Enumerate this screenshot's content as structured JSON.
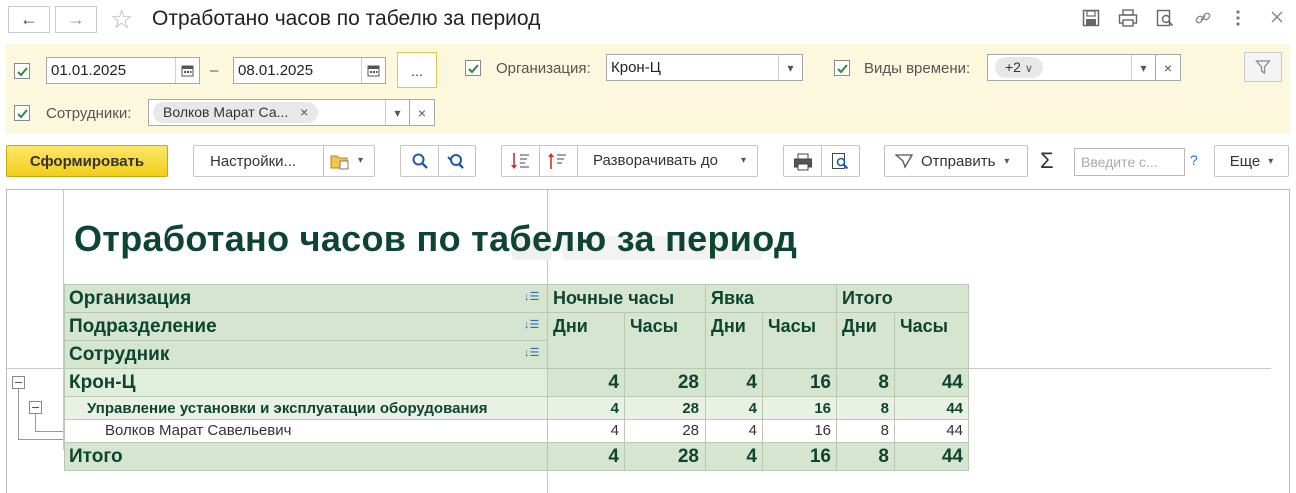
{
  "window": {
    "back_icon": "←",
    "forward_icon": "→",
    "favorite_icon": "☆",
    "title": "Отработано часов по табелю за период"
  },
  "filters": {
    "date_from": "01.01.2025",
    "date_dash": "–",
    "date_to": "08.01.2025",
    "dots_label": "...",
    "org_label": "Организация:",
    "org_value": "Крон-Ц",
    "time_types_label": "Виды времени:",
    "time_types_chip": "+2",
    "employees_label": "Сотрудники:",
    "employees_chip": "Волков Марат Са...",
    "clear_symbol": "×"
  },
  "toolbar": {
    "generate": "Сформировать",
    "settings": "Настройки...",
    "expand_to": "Разворачивать до",
    "send": "Отправить",
    "sigma": "Σ",
    "search_placeholder": "Введите с...",
    "help": "?",
    "more": "Еще"
  },
  "report": {
    "title": "Отработано часов по табелю за период",
    "header": {
      "org": "Организация",
      "dept": "Подразделение",
      "employee": "Сотрудник",
      "night": "Ночные часы",
      "attendance": "Явка",
      "total": "Итого",
      "days": "Дни",
      "hours": "Часы"
    },
    "rows": [
      {
        "name": "Крон-Ц",
        "values": [
          "4",
          "28",
          "4",
          "16",
          "8",
          "44"
        ]
      },
      {
        "name": "Управление установки и эксплуатации оборудования",
        "values": [
          "4",
          "28",
          "4",
          "16",
          "8",
          "44"
        ]
      },
      {
        "name": "Волков Марат Савельевич",
        "values": [
          "4",
          "28",
          "4",
          "16",
          "8",
          "44"
        ]
      }
    ],
    "totals": {
      "name": "Итого",
      "values": [
        "4",
        "28",
        "4",
        "16",
        "8",
        "44"
      ]
    }
  },
  "colors": {
    "accent_yellow": "#f1cd1b",
    "filter_panel_bg": "#fbf8dd",
    "header_green": "#d6e5d0",
    "text_dark_green": "#0d4530"
  }
}
